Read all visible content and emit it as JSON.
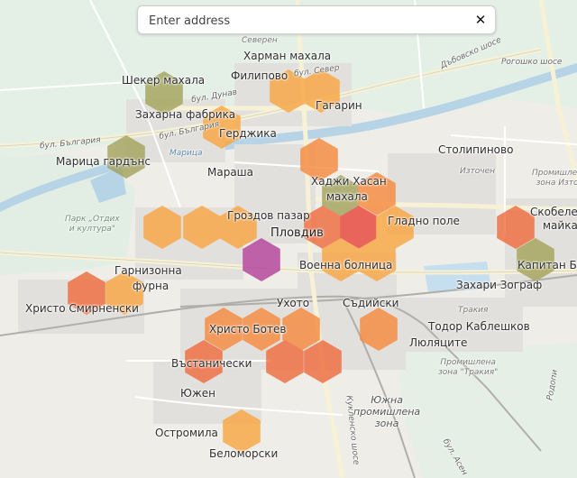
{
  "search": {
    "placeholder": "Enter address",
    "clear_icon": "close-icon"
  },
  "places": {
    "severen": "Северен",
    "harman_mahala": "Харман махала",
    "filipovo": "Филипово",
    "sheker_mahala": "Шекер махала",
    "zaharna_fabrika": "Захарна фабрика",
    "gagarin": "Гагарин",
    "gerdzhika": "Герджика",
    "maritsa_gardens": "Марица гардънс",
    "stolipinovo": "Столипиново",
    "marasha": "Мараша",
    "iztochen": "Източен",
    "hadzhi_hasan": "Хаджи Хасан",
    "mahala": "махала",
    "promishlena_1": "Промишлена",
    "zona_istok": "зона Изток",
    "skobelev": "Скобелев",
    "maika": "майка",
    "park_otdih_1": "Парк „Отдих",
    "park_otdih_2": "и култура\"",
    "grozdov_pazar": "Гроздов пазар",
    "gladno_pole": "Гладно поле",
    "plovdiv": "Пловдив",
    "kapitan_bu": "Капитан Бу",
    "garnizonna": "Гарнизонна",
    "furna": "фурна",
    "voenna_bolnitsa": "Военна болница",
    "zahari_zograf": "Захари Зограф",
    "hristo_smirnenski": "Христо Смирненски",
    "uhoto": "Ухото",
    "sadiyski": "Съдийски",
    "trakia": "Тракия",
    "hristo_botev": "Христо Ботев",
    "todor_kableshkov": "Тодор Каблешков",
    "lyulyatsite": "Люляците",
    "vastanicheski": "Въстанически",
    "promishlena_2": "Промишлена",
    "zona_trakia": "зона \"Тракия\"",
    "yuzhen": "Южен",
    "yuzhna_1": "Южна",
    "yuzhna_2": "промишлена",
    "yuzhna_3": "зона",
    "ostromila": "Остромила",
    "belomorski": "Беломорски"
  },
  "roads": {
    "bul_sever": "бул. Север",
    "bul_dunav": "бул. Дунав",
    "bul_bulgaria_1": "бул. България",
    "bul_bulgaria_2": "бул. България",
    "maritsa": "Марица",
    "dabovska": "Дъбовско шосе",
    "rogoshko": "Рогошко шосе",
    "rodopi": "Родопи",
    "kukleshko": "Кукленско шосе",
    "avtomagistrala": "бул. Асен"
  },
  "heat_colors": {
    "yellow_orange": "#f9a53f",
    "orange": "#f6893b",
    "red_orange": "#ef6a3c",
    "red": "#e8443a",
    "olive": "#a3a25a",
    "purple": "#b33f9a"
  },
  "hexagons": [
    {
      "id": "hex-sheker",
      "level": "olive"
    },
    {
      "id": "hex-filipovo",
      "level": "yellow_orange"
    },
    {
      "id": "hex-gagarin",
      "level": "yellow_orange"
    },
    {
      "id": "hex-gerdzhika",
      "level": "yellow_orange"
    },
    {
      "id": "hex-maritsa-gardens",
      "level": "olive"
    },
    {
      "id": "hex-hadzhi-hasan",
      "level": "orange"
    },
    {
      "id": "hex-center-north",
      "level": "olive"
    },
    {
      "id": "hex-center-east",
      "level": "orange"
    },
    {
      "id": "hex-west-1",
      "level": "yellow_orange"
    },
    {
      "id": "hex-west-2",
      "level": "yellow_orange"
    },
    {
      "id": "hex-grozdov",
      "level": "yellow_orange"
    },
    {
      "id": "hex-center-1",
      "level": "red_orange"
    },
    {
      "id": "hex-center-2",
      "level": "red"
    },
    {
      "id": "hex-gladno-pole",
      "level": "yellow_orange"
    },
    {
      "id": "hex-voenna",
      "level": "yellow_orange"
    },
    {
      "id": "hex-voenna-2",
      "level": "yellow_orange"
    },
    {
      "id": "hex-purple",
      "level": "purple"
    },
    {
      "id": "hex-skobelev",
      "level": "red_orange"
    },
    {
      "id": "hex-kapitan",
      "level": "olive"
    },
    {
      "id": "hex-smirnenski-1",
      "level": "red_orange"
    },
    {
      "id": "hex-smirnenski-2",
      "level": "yellow_orange"
    },
    {
      "id": "hex-sadiyski",
      "level": "orange"
    },
    {
      "id": "hex-botev-1",
      "level": "orange"
    },
    {
      "id": "hex-botev-2",
      "level": "orange"
    },
    {
      "id": "hex-botev-3",
      "level": "orange"
    },
    {
      "id": "hex-vastanicheski",
      "level": "red_orange"
    },
    {
      "id": "hex-south-1",
      "level": "red_orange"
    },
    {
      "id": "hex-south-2",
      "level": "red_orange"
    },
    {
      "id": "hex-belomorski",
      "level": "yellow_orange"
    }
  ]
}
